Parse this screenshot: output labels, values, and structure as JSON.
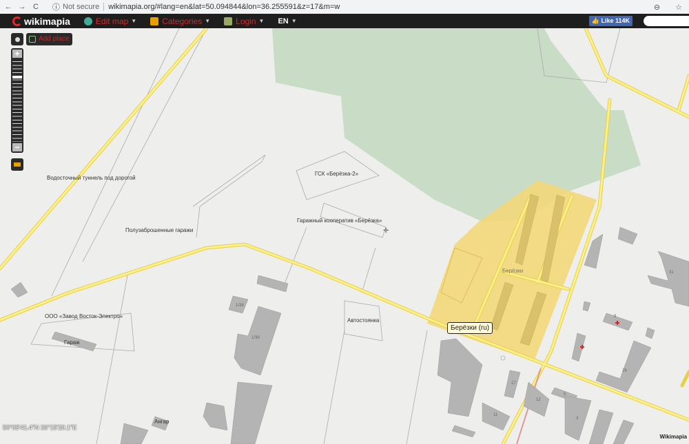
{
  "browser": {
    "back": "←",
    "forward": "→",
    "reload": "C",
    "security": "Not secure",
    "url": "wikimapia.org/#lang=en&lat=50.094844&lon=36.255591&z=17&m=w"
  },
  "topbar": {
    "logo": "wikimapia",
    "menu": [
      {
        "label": "Edit map"
      },
      {
        "label": "Categories"
      },
      {
        "label": "Login"
      },
      {
        "label": "EN"
      }
    ],
    "like": "Like 114K"
  },
  "controls": {
    "add_place": "Add place",
    "zoom_in": "+",
    "zoom_out": "−",
    "zoom_level": 17,
    "zoom_fraction": 0.2
  },
  "map": {
    "labels": [
      "Водосточный туннель под дорогой",
      "ГСК «Берёзка-2»",
      "Гаражный кооператив «Берёзка»",
      "Полузаброшенные гаражи",
      "ООО «Завод Восток-Электро»",
      "Гараж",
      "Автостоянка",
      "Берёзки",
      "Ангар"
    ],
    "building_numbers": [
      "1/39",
      "1/38",
      "31",
      "9",
      "29",
      "17",
      "12",
      "11",
      "5",
      "3"
    ],
    "tooltip": "Берёзки (ru)",
    "coords": "50°05'41.4\"N 36°15'20.1\"E",
    "credit": "Wikimapia",
    "colors": {
      "road": "#f5e04a",
      "park": "#c9dcc5",
      "highlight": "#f3d77a",
      "building": "#b4b4b4"
    }
  }
}
